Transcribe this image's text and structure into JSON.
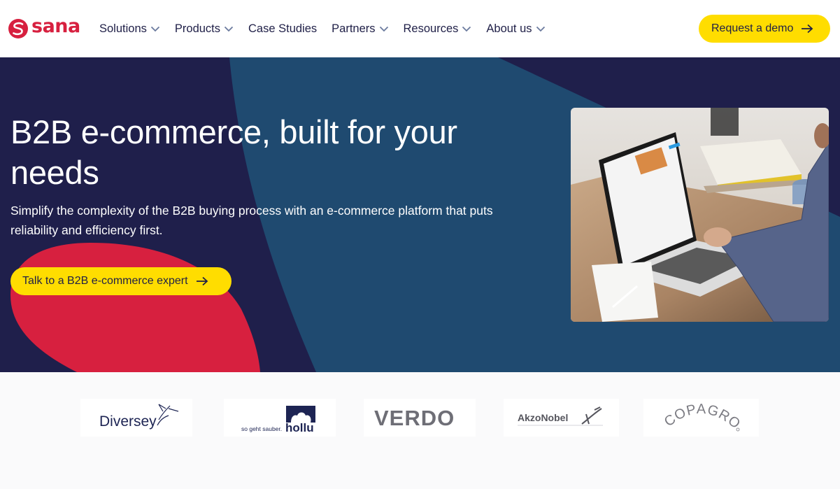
{
  "brand": {
    "name": "sana",
    "color": "#d7203f",
    "logo_icon": "sana-s-mark-icon"
  },
  "nav": {
    "items": [
      {
        "label": "Solutions",
        "has_dropdown": true
      },
      {
        "label": "Products",
        "has_dropdown": true
      },
      {
        "label": "Case Studies",
        "has_dropdown": false
      },
      {
        "label": "Partners",
        "has_dropdown": true
      },
      {
        "label": "Resources",
        "has_dropdown": true
      },
      {
        "label": "About us",
        "has_dropdown": true
      }
    ],
    "cta_label": "Request a demo",
    "cta_icon": "arrow-right-icon"
  },
  "hero": {
    "title": "B2B e-commerce, built for your needs",
    "subtitle": "Simplify the complexity of the B2B buying process with an e-commerce platform that puts reliability and efficiency first.",
    "cta_label": "Talk to a B2B e-commerce expert",
    "cta_icon": "arrow-right-icon",
    "image_alt": "Person working on a laptop at a wooden desk with a notebook and coffee cup",
    "colors": {
      "navy": "#1f1f4b",
      "teal": "#1f4a70",
      "red": "#d7203f",
      "yellow": "#ffdd00"
    }
  },
  "customer_logos": [
    {
      "name": "Diversey"
    },
    {
      "name": "hollu",
      "tagline": "so geht sauber."
    },
    {
      "name": "VERDO"
    },
    {
      "name": "AkzoNobel"
    },
    {
      "name": "COPAGRO"
    }
  ]
}
